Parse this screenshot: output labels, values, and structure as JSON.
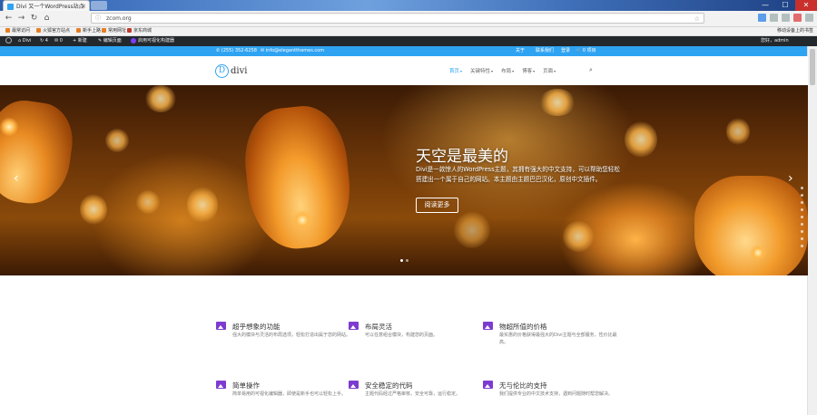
{
  "browser": {
    "tab_title": "Divi 又一个WordPress站点",
    "url": "zcom.org",
    "window_controls": {
      "minimize": "—",
      "maximize": "☐",
      "close": "✕"
    },
    "toolbar_icons": [
      "menu-icon",
      "extension-icon",
      "reader-icon",
      "screenshot-icon",
      "account-icon"
    ]
  },
  "bookmarks": [
    {
      "label": "最常访问"
    },
    {
      "label": "火狐官方站点"
    },
    {
      "label": "新手上路"
    },
    {
      "label": "常用网址"
    },
    {
      "label": "京东商城"
    }
  ],
  "bookmarks_right": "移动设备上的书签",
  "wp_admin_bar": {
    "site": "Divi",
    "updates": "4",
    "comments": "0",
    "new": "新建",
    "edit_page": "编辑页面",
    "visual_builder": "启用可视化构建器",
    "greeting": "您好，admin"
  },
  "top_header": {
    "phone": "(255) 352-6258",
    "email": "info@elegantthemes.com",
    "links": [
      "关于",
      "联系我们",
      "登录"
    ],
    "cart": "0 项目"
  },
  "logo": {
    "letter": "D",
    "text": "divi"
  },
  "menu": [
    {
      "label": "首页",
      "active": true,
      "caret": true
    },
    {
      "label": "关键特性",
      "active": false,
      "caret": true
    },
    {
      "label": "布局",
      "active": false,
      "caret": true
    },
    {
      "label": "博客",
      "active": false,
      "caret": true
    },
    {
      "label": "页面",
      "active": false,
      "caret": true
    }
  ],
  "hero": {
    "title": "天空是最美的",
    "description": "Divi是一款惊人的WordPress主题，其拥有强大的中文支持，可以帮助您轻松搭建出一个属于自己的网站。本主题由主题巴巴汉化，原创中文插件。",
    "button": "阅读更多",
    "prev": "‹",
    "next": "›"
  },
  "features": [
    {
      "title": "超乎想象的功能",
      "desc": "强大的模块与灵活的布局选项，轻松打造出属于您的网站。"
    },
    {
      "title": "布局灵活",
      "desc": "可以任意组合模块，构建您的页面。"
    },
    {
      "title": "物超所值的价格",
      "desc": "最实惠的价格获得最强大的Divi主题与全部服务，性价比最高。"
    },
    {
      "title": "简单操作",
      "desc": "简单易用的可视化编辑器，即使是新手也可以轻松上手。"
    },
    {
      "title": "安全稳定的代码",
      "desc": "主题代码经过严格审核，安全可靠，运行稳定。"
    },
    {
      "title": "无与伦比的支持",
      "desc": "我们提供专业的中文技术支持，遇到问题随时帮您解决。"
    }
  ]
}
